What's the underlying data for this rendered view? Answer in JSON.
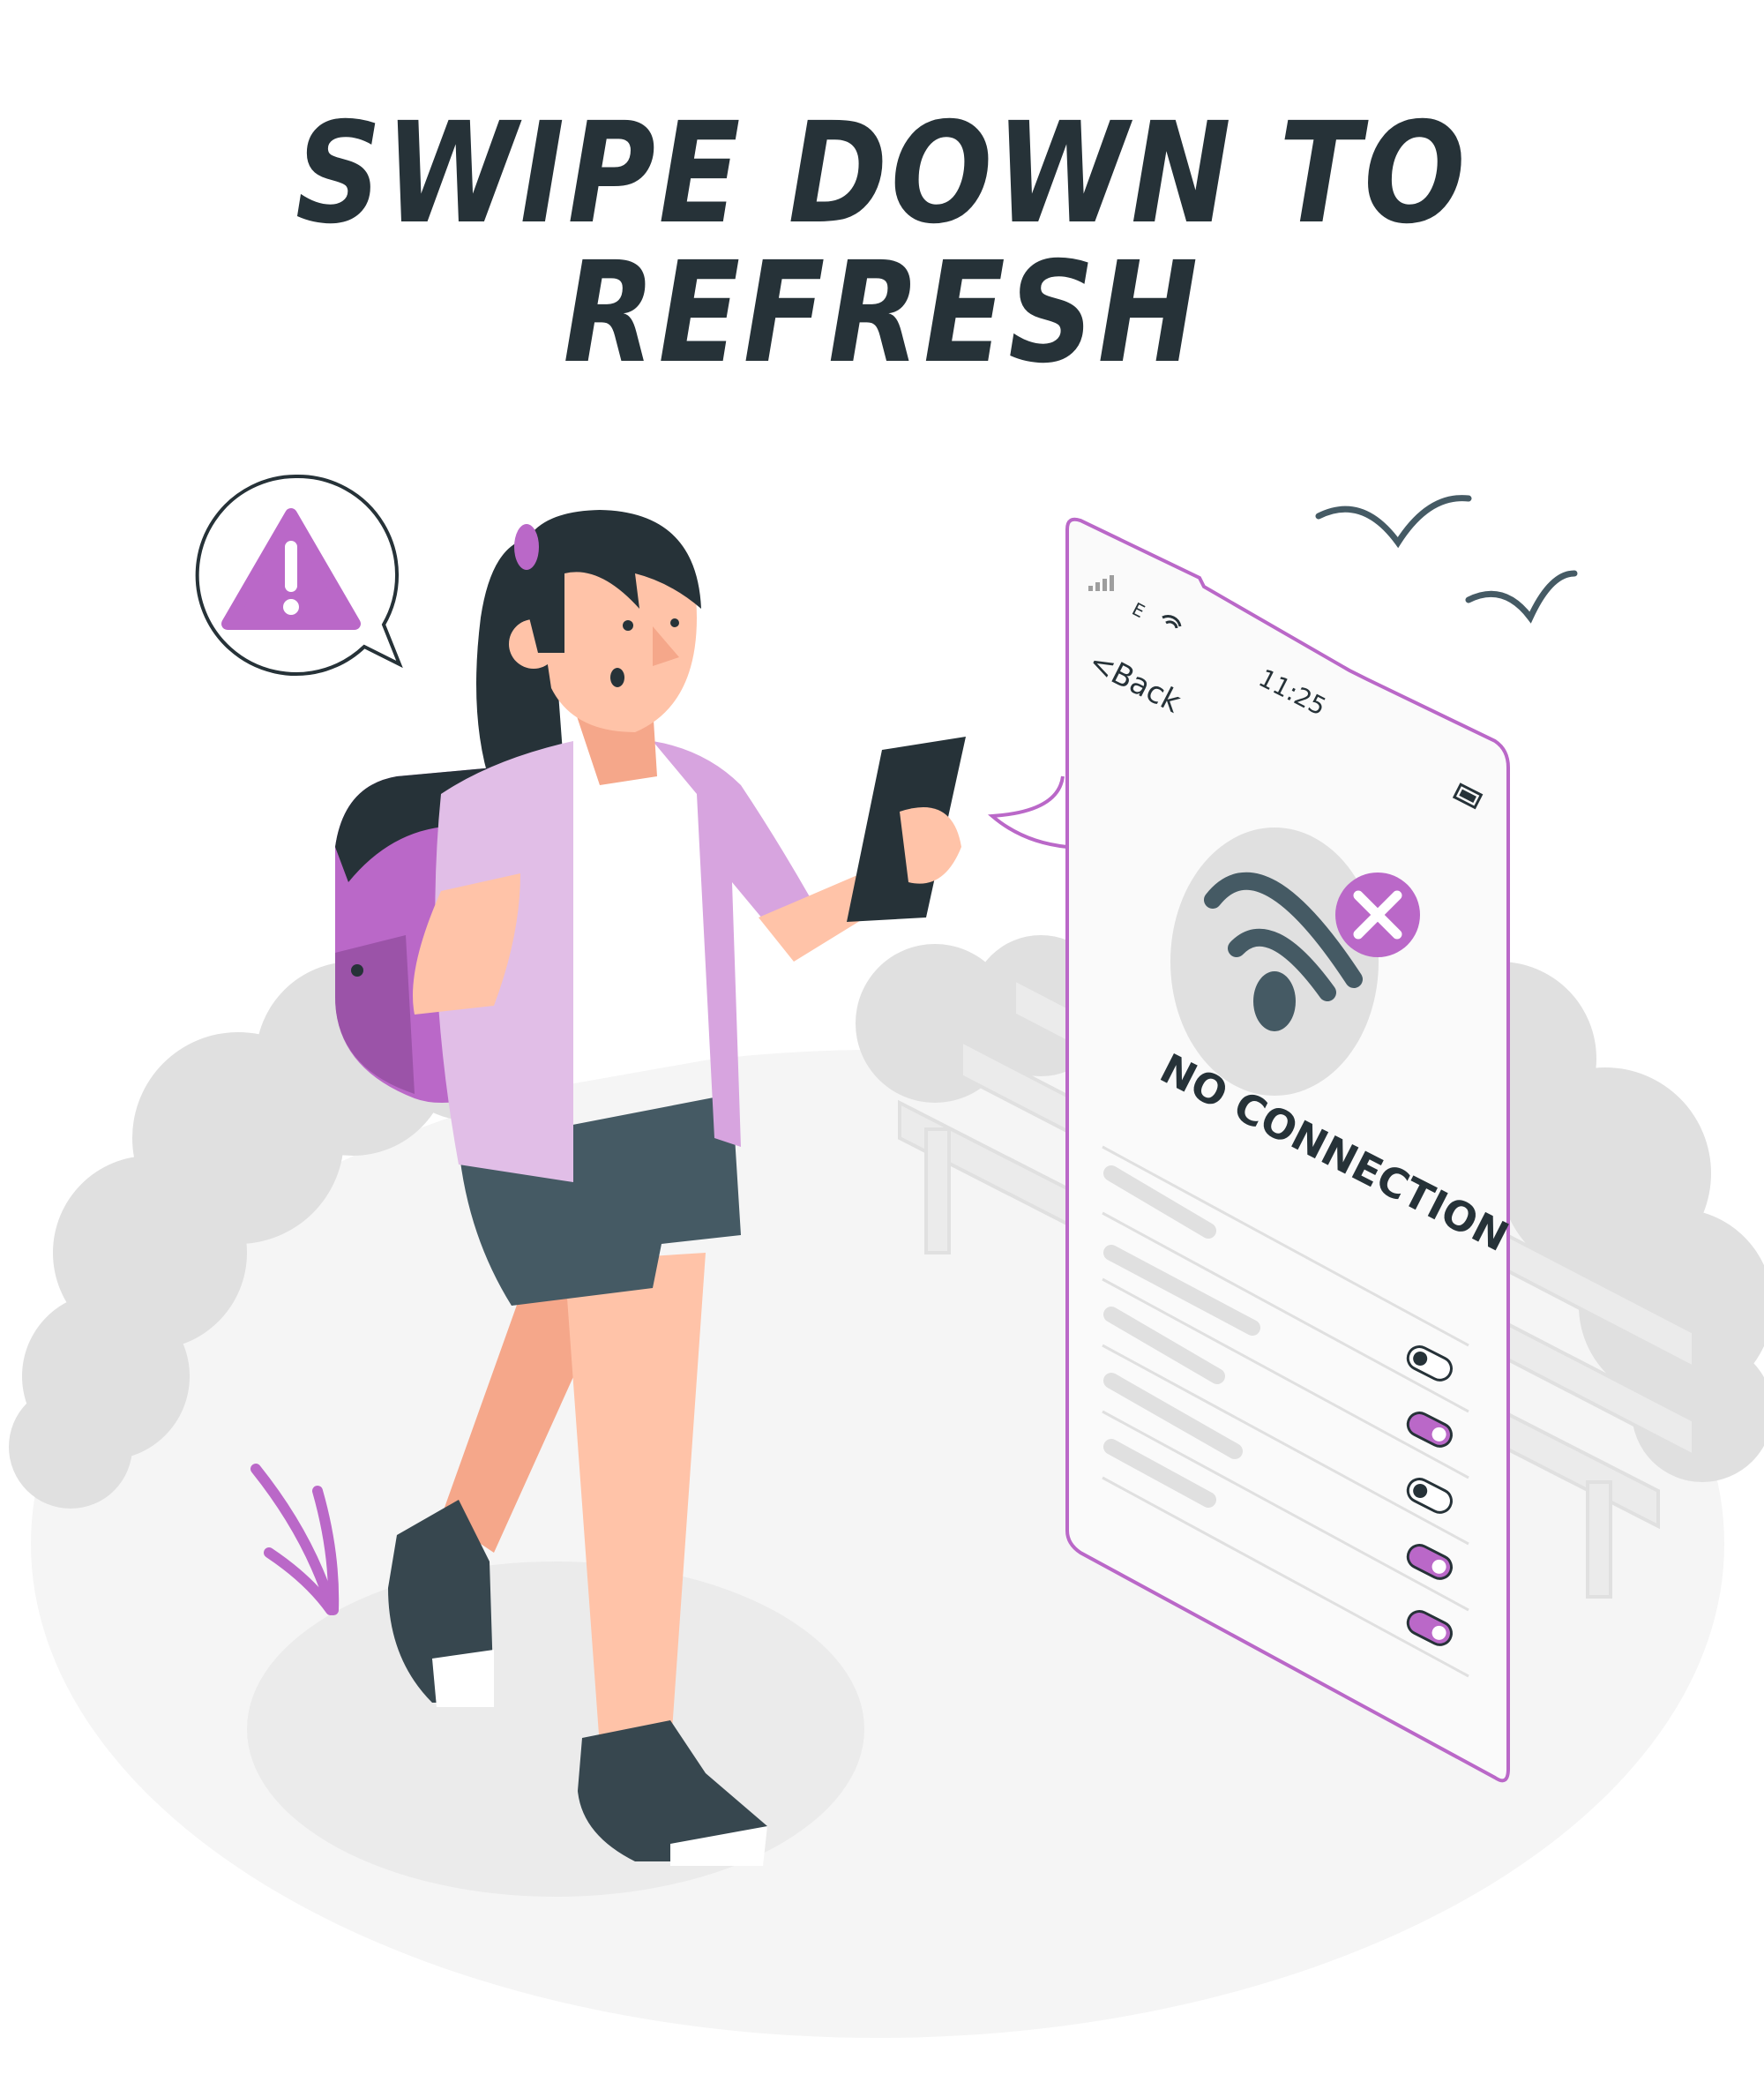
{
  "headline": "SWIPE DOWN TO REFRESH",
  "phone": {
    "signal_label": "E",
    "back_label": "<Back",
    "time": "11:25",
    "status_title": "NO CONNECTION",
    "toggles": [
      {
        "state": "off"
      },
      {
        "state": "on"
      },
      {
        "state": "off"
      },
      {
        "state": "on"
      },
      {
        "state": "on"
      }
    ]
  },
  "icons": {
    "warning": "warning-triangle-icon",
    "wifi_off": "wifi-off-icon",
    "battery": "battery-icon",
    "cellular_signal": "cellular-signal-icon",
    "wifi_status": "wifi-status-icon"
  },
  "colors": {
    "accent": "#BA68C8",
    "dark": "#263238",
    "gray": "#E0E0E0",
    "skin": "#FFC3A8"
  }
}
